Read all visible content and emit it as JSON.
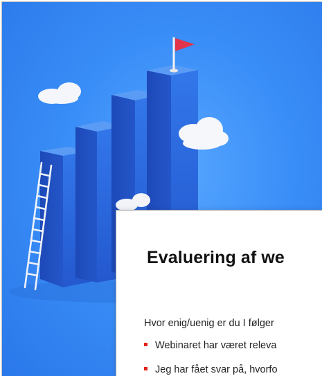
{
  "slide": {
    "title": "Evaluering af we",
    "question": "Hvor enig/uenig er du I følger",
    "bullets": [
      "Webinaret har været releva",
      "Jeg har fået svar på, hvorfo"
    ]
  },
  "colors": {
    "background_blue": "#3a8ef7",
    "bar_blue": "#2f6fe0",
    "flag_red": "#e2344a",
    "bullet_red": "#e2231a"
  }
}
